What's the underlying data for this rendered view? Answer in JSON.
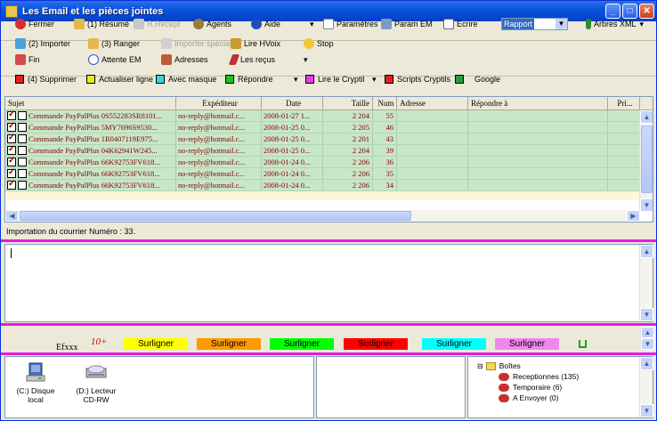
{
  "window": {
    "title": "Les Email et les pièces jointes",
    "controls": [
      "_",
      "□",
      "✕"
    ]
  },
  "toolbar1": {
    "fermer": "Fermer",
    "resume": "(1) Résumé",
    "rrecept": "R.Récept",
    "agents": "Agents",
    "aide": "Aide",
    "parametres": "Paramètres",
    "param_em": "Param EM",
    "ecrire": "Ecrire",
    "rapport_value": "Rapport",
    "arbres_xml": "Arbres XML"
  },
  "toolbar2": {
    "importer": "(2) Importer",
    "ranger": "(3) Ranger",
    "importer_special": "Importer spécial",
    "lire_hvoix": "Lire HVoix",
    "stop": "Stop"
  },
  "toolbar3": {
    "fin": "Fin",
    "attente_em": "Attente EM",
    "adresses": "Adresses",
    "les_recus": "Les reçus"
  },
  "toolbar4": {
    "supprimer": "(4) Supprimer",
    "actualiser": "Actualiser ligne",
    "avec_masque": "Avec masque",
    "repondre": "Répondre",
    "lire_cryptil": "Lire le Cryptil",
    "scripts_cryptils": "Scripts Cryptils",
    "google": "Google"
  },
  "grid": {
    "columns": [
      "Sujet",
      "Expéditeur",
      "Date",
      "Taille",
      "Num",
      "Adresse",
      "Répondre à",
      "Pri..."
    ],
    "rows": [
      {
        "sujet": "Commande PayPalPlus 0S552283SR8101...",
        "exp": "no-reply@hotmail.c...",
        "date": "2008-01-27 1...",
        "taille": "2 204",
        "num": "55"
      },
      {
        "sujet": "Commande PayPalPlus 5MY7696S9530...",
        "exp": "no-reply@hotmail.c...",
        "date": "2008-01-25 0...",
        "taille": "2 205",
        "num": "46"
      },
      {
        "sujet": "Commande PayPalPlus 1R0407119E975...",
        "exp": "no-reply@hotmail.c...",
        "date": "2008-01-25 0...",
        "taille": "2 201",
        "num": "43"
      },
      {
        "sujet": "Commande PayPalPlus 04K62941W245...",
        "exp": "no-reply@hotmail.c...",
        "date": "2008-01-25 0...",
        "taille": "2 204",
        "num": "39"
      },
      {
        "sujet": "Commande PayPalPlus 66K92753FV618...",
        "exp": "no-reply@hotmail.c...",
        "date": "2008-01-24 0...",
        "taille": "2 206",
        "num": "36"
      },
      {
        "sujet": "Commande PayPalPlus 66K92753FV618...",
        "exp": "no-reply@hotmail.c...",
        "date": "2008-01-24 0...",
        "taille": "2 206",
        "num": "35"
      },
      {
        "sujet": "Commande PayPalPlus 66K92753FV618...",
        "exp": "no-reply@hotmail.c...",
        "date": "2008-01-24 0...",
        "taille": "2 206",
        "num": "34"
      }
    ]
  },
  "status": "Importation du courrier Numéro : 33.",
  "surligner": {
    "efxxx": "Efxxx",
    "tenp": "10+",
    "label": "Surligner",
    "colors": [
      "#ffff00",
      "#ff9900",
      "#00ff00",
      "#ff0000",
      "#00ffff",
      "#ee88ee"
    ]
  },
  "drives": [
    {
      "label1": "(C:) Disque",
      "label2": "local"
    },
    {
      "label1": "(D:) Lecteur",
      "label2": "CD-RW"
    }
  ],
  "tree": {
    "root": "Boîtes",
    "items": [
      "Receptionnes (135)",
      "Temporaire (6)",
      "A Envoyer (0)"
    ]
  }
}
